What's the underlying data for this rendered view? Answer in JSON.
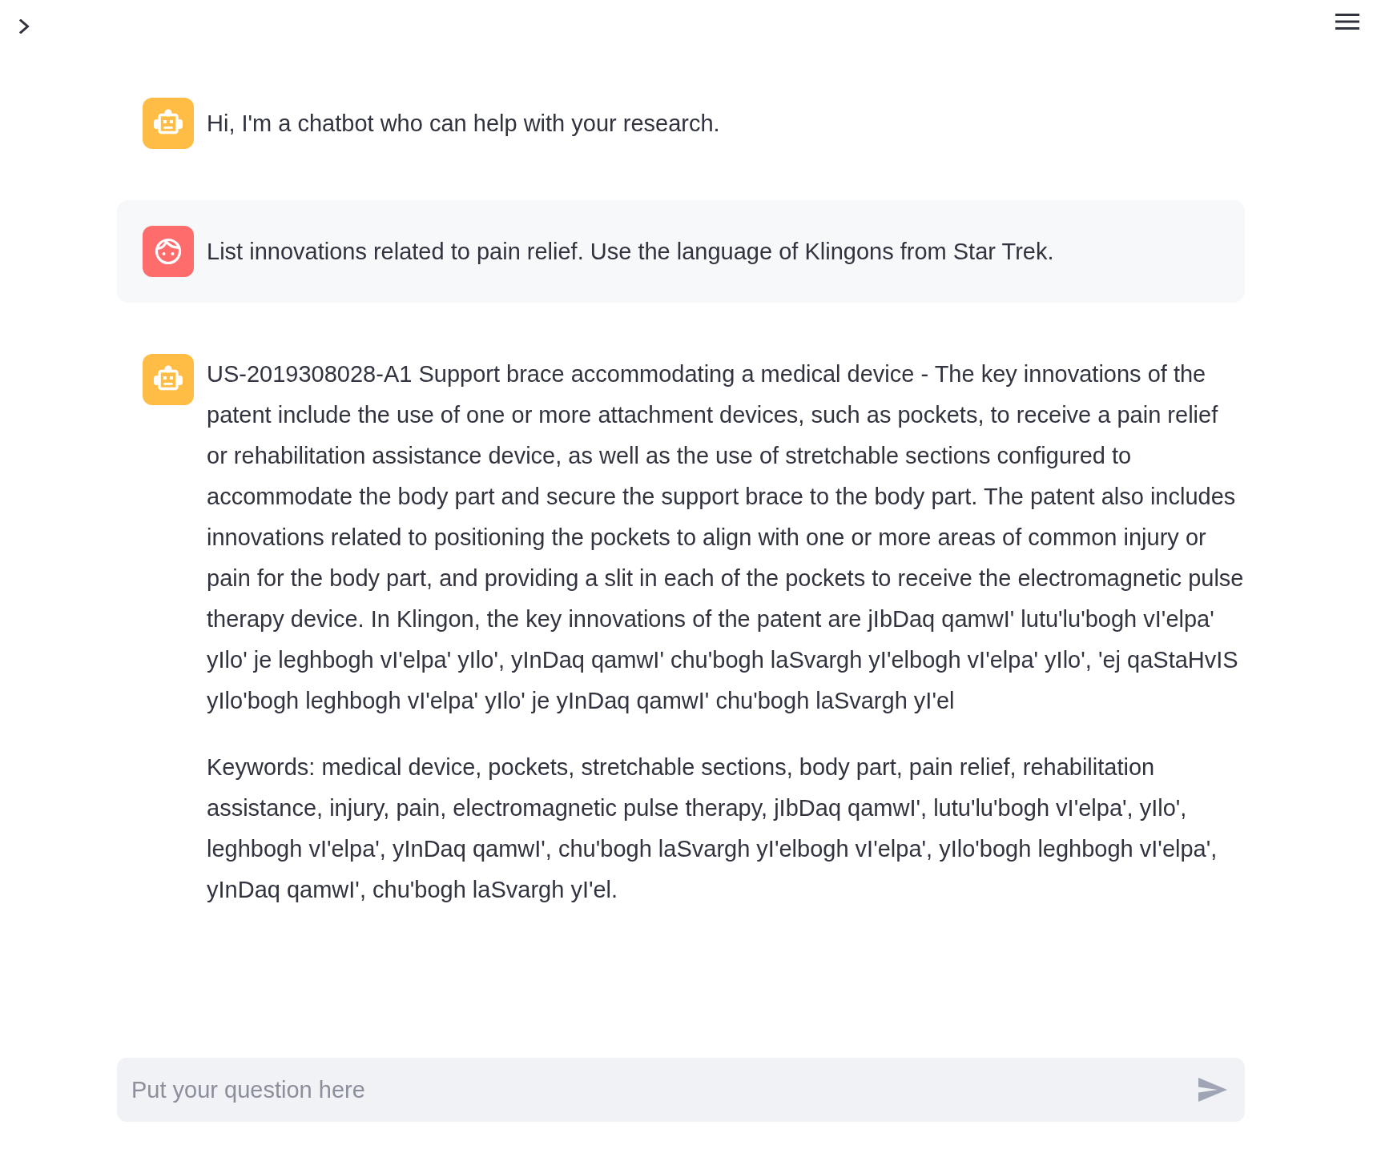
{
  "messages": [
    {
      "kind": "assistant",
      "paragraphs": [
        "Hi, I'm a chatbot who can help with your research."
      ]
    },
    {
      "kind": "user",
      "paragraphs": [
        "List innovations related to pain relief. Use the language of Klingons from Star Trek."
      ]
    },
    {
      "kind": "assistant",
      "paragraphs": [
        "US-2019308028-A1 Support brace accommodating a medical device - The key innovations of the patent include the use of one or more attachment devices, such as pockets, to receive a pain relief or rehabilitation assistance device, as well as the use of stretchable sections configured to accommodate the body part and secure the support brace to the body part. The patent also includes innovations related to positioning the pockets to align with one or more areas of common injury or pain for the body part, and providing a slit in each of the pockets to receive the electromagnetic pulse therapy device. In Klingon, the key innovations of the patent are jIbDaq qamwI' lutu'lu'bogh vI'elpa' yIlo' je leghbogh vI'elpa' yIlo', yInDaq qamwI' chu'bogh laSvargh yI'elbogh vI'elpa' yIlo', 'ej qaStaHvIS yIlo'bogh leghbogh vI'elpa' yIlo' je yInDaq qamwI' chu'bogh laSvargh yI'el",
        "Keywords: medical device, pockets, stretchable sections, body part, pain relief, rehabilitation assistance, injury, pain, electromagnetic pulse therapy, jIbDaq qamwI', lutu'lu'bogh vI'elpa', yIlo', leghbogh vI'elpa', yInDaq qamwI', chu'bogh laSvargh yI'elbogh vI'elpa', yIlo'bogh leghbogh vI'elpa', yInDaq qamwI', chu'bogh laSvargh yI'el."
      ]
    }
  ],
  "chat_input": {
    "placeholder": "Put your question here"
  }
}
